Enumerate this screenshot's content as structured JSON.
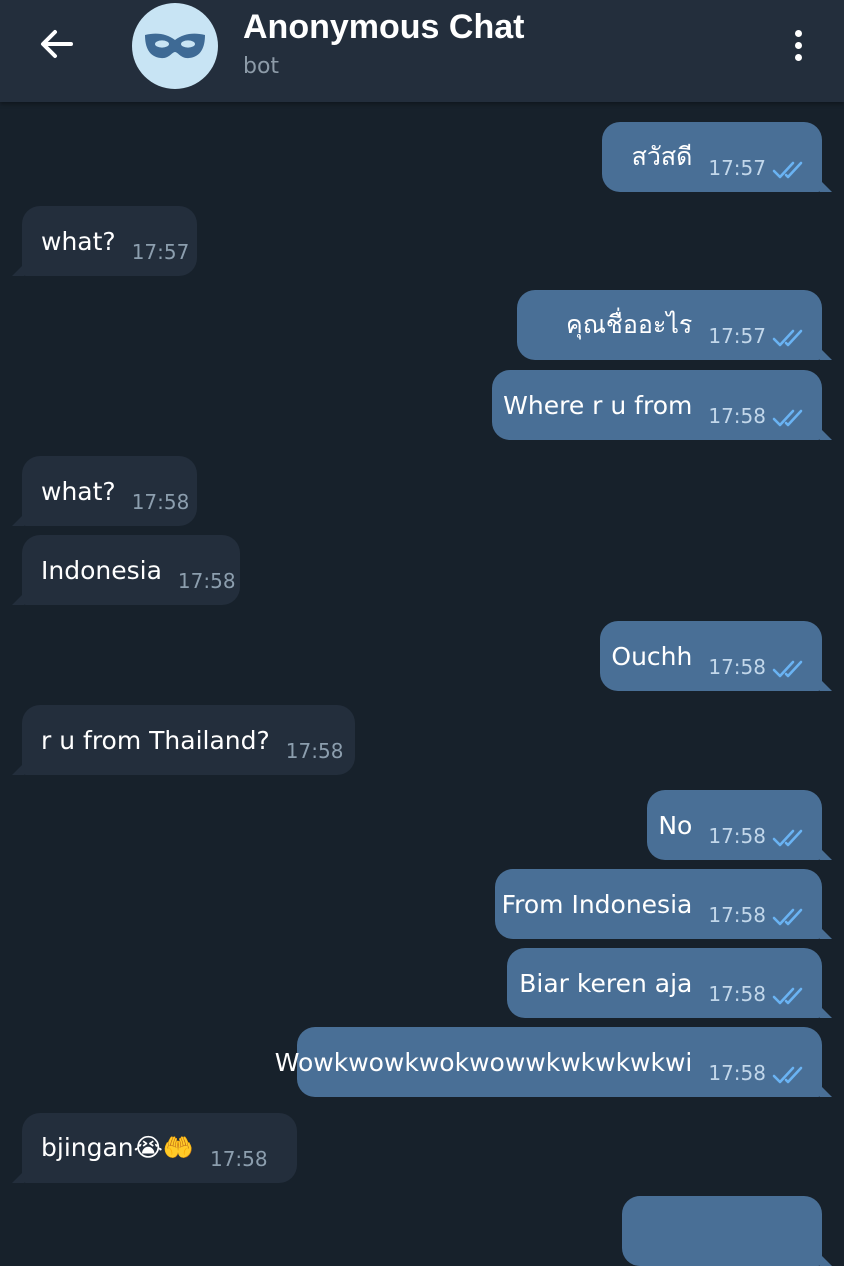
{
  "header": {
    "title": "Anonymous Chat",
    "subtitle": "bot",
    "back_icon": "arrow-left-icon",
    "avatar_icon": "mask-icon",
    "menu_icon": "more-vertical-icon"
  },
  "colors": {
    "background": "#17212b",
    "header": "#232e3c",
    "incoming_bubble": "#232e3c",
    "outgoing_bubble": "#496f96",
    "read_ticks": "#6ab3f3",
    "avatar_bg": "#c8e4f4"
  },
  "messages": [
    {
      "direction": "out",
      "text": "สวัสดี",
      "time": "17:57",
      "status": "read"
    },
    {
      "direction": "in",
      "text": "what?",
      "time": "17:57"
    },
    {
      "direction": "out",
      "text": "คุณชื่ออะไร",
      "time": "17:57",
      "status": "read"
    },
    {
      "direction": "out",
      "text": "Where r u from",
      "time": "17:58",
      "status": "read"
    },
    {
      "direction": "in",
      "text": "what?",
      "time": "17:58"
    },
    {
      "direction": "in",
      "text": "Indonesia",
      "time": "17:58"
    },
    {
      "direction": "out",
      "text": "Ouchh",
      "time": "17:58",
      "status": "read"
    },
    {
      "direction": "in",
      "text": "r u from Thailand?",
      "time": "17:58"
    },
    {
      "direction": "out",
      "text": "No",
      "time": "17:58",
      "status": "read"
    },
    {
      "direction": "out",
      "text": "From Indonesia",
      "time": "17:58",
      "status": "read"
    },
    {
      "direction": "out",
      "text": "Biar keren aja",
      "time": "17:58",
      "status": "read"
    },
    {
      "direction": "out",
      "text": "Wowkwowkwokwowwkwkwkwkwi",
      "time": "17:58",
      "status": "read"
    },
    {
      "direction": "in",
      "text": "bjingan😭🤲",
      "time": "17:58"
    }
  ]
}
